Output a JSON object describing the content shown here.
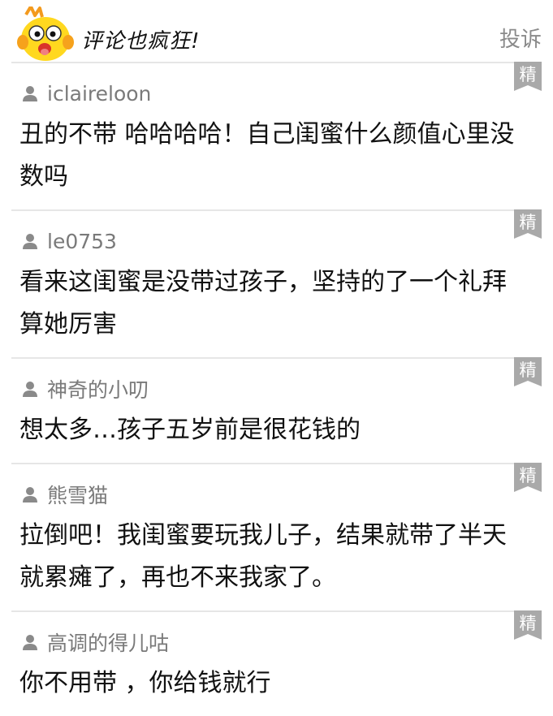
{
  "header": {
    "title": "评论也疯狂!",
    "report_label": "投诉"
  },
  "badge_label": "精",
  "comments": [
    {
      "username": "iclaireloon",
      "text": "丑的不带 哈哈哈哈！自己闺蜜什么颜值心里没数吗"
    },
    {
      "username": "le0753",
      "text": "看来这闺蜜是没带过孩子，坚持的了一个礼拜算她厉害"
    },
    {
      "username": "神奇的小叨",
      "text": "想太多…孩子五岁前是很花钱的"
    },
    {
      "username": "熊雪猫",
      "text": "拉倒吧！我闺蜜要玩我儿子，结果就带了半天就累瘫了，再也不来我家了。"
    },
    {
      "username": "高调的得儿咕",
      "text": "你不用带 ，你给钱就行"
    }
  ]
}
